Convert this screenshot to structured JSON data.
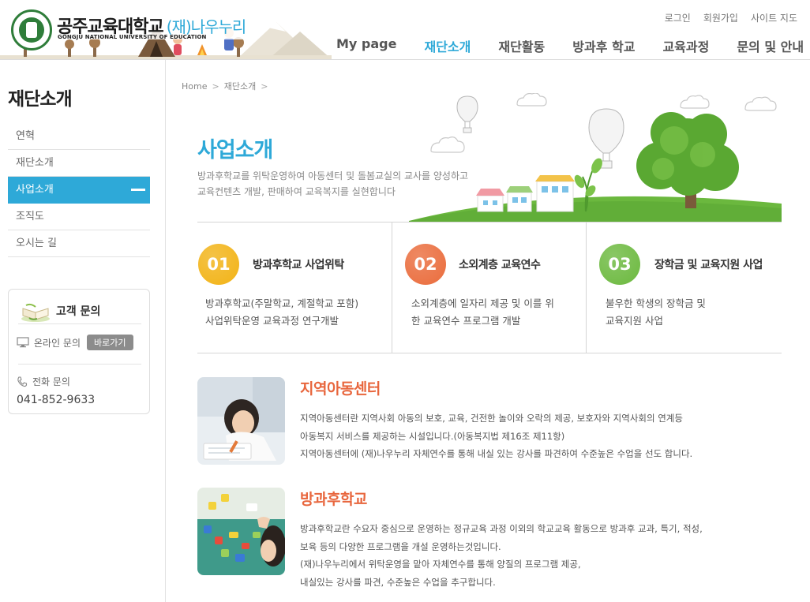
{
  "header": {
    "logo_title": "공주교육대학교",
    "logo_sub": "(재)나우누리",
    "logo_eng": "GONGJU NATIONAL UNIVERSITY OF EDUCATION",
    "util": [
      "로그인",
      "회원가입",
      "사이트 지도"
    ],
    "gnb": [
      {
        "label": "My page",
        "active": false
      },
      {
        "label": "재단소개",
        "active": true
      },
      {
        "label": "재단활동",
        "active": false
      },
      {
        "label": "방과후 학교",
        "active": false
      },
      {
        "label": "교육과정",
        "active": false
      },
      {
        "label": "문의 및 안내",
        "active": false
      }
    ]
  },
  "sidebar": {
    "title": "재단소개",
    "items": [
      {
        "label": "연혁",
        "active": false
      },
      {
        "label": "재단소개",
        "active": false
      },
      {
        "label": "사업소개",
        "active": true
      },
      {
        "label": "조직도",
        "active": false
      },
      {
        "label": "오시는 길",
        "active": false
      }
    ],
    "cs": {
      "title": "고객 문의",
      "online_label": "온라인 문의",
      "online_button": "바로가기",
      "phone_label": "전화 문의",
      "phone": "041-852-9633"
    }
  },
  "breadcrumb": [
    "Home",
    "재단소개"
  ],
  "hero": {
    "title": "사업소개",
    "desc_line1": "방과후학교를 위탁운영하여 아동센터 및 돌봄교실의 교사를 양성하고",
    "desc_line2": "교육컨텐츠 개발, 판매하여 교육복지를 실현합니다"
  },
  "business": [
    {
      "num": "01",
      "title": "방과후학교 사업위탁",
      "line1": "방과후학교(주말학교, 계절학교 포함)",
      "line2": "사업위탁운영 교육과정 연구개발",
      "color": "#f2b316"
    },
    {
      "num": "02",
      "title": "소외계층 교육연수",
      "line1": "소외계층에 일자리 제공 및 이를 위",
      "line2": "한 교육연수 프로그램 개발",
      "color": "#ea6c3c"
    },
    {
      "num": "03",
      "title": "장학금 및 교육지원 사업",
      "line1": "불우한 학생의 장학금 및",
      "line2": "교육지원 사업",
      "color": "#6cb93f"
    }
  ],
  "features": [
    {
      "title": "지역아동센터",
      "lines": [
        "지역아동센터란 지역사회 아동의 보호, 교육, 건전한 놀이와 오락의 제공, 보호자와 지역사회의 연계등",
        "아동복지 서비스를 제공하는 시설입니다.(아동복지법 제16조 제11항)",
        "지역아동센터에 (재)나우누리 자체연수를 통해 내실 있는 강사를 파견하여 수준높은 수업을 선도 합니다."
      ]
    },
    {
      "title": "방과후학교",
      "lines": [
        "방과후학교란 수요자 중심으로 운영하는 정규교육 과정 이외의 학교교육 활동으로 방과후 교과, 특기, 적성,",
        "보육 등의 다양한 프로그램을 개설 운영하는것입니다.",
        "(재)나우누리에서 위탁운영을 맡아 자체연수를 통해 양질의 프로그램 제공,",
        "내실있는 강사를 파견, 수준높은 수업을 추구합니다."
      ]
    }
  ],
  "colors": {
    "accent": "#2ea9d8",
    "feature_title": "#e8663d",
    "emblem": "#2f7d3a"
  }
}
